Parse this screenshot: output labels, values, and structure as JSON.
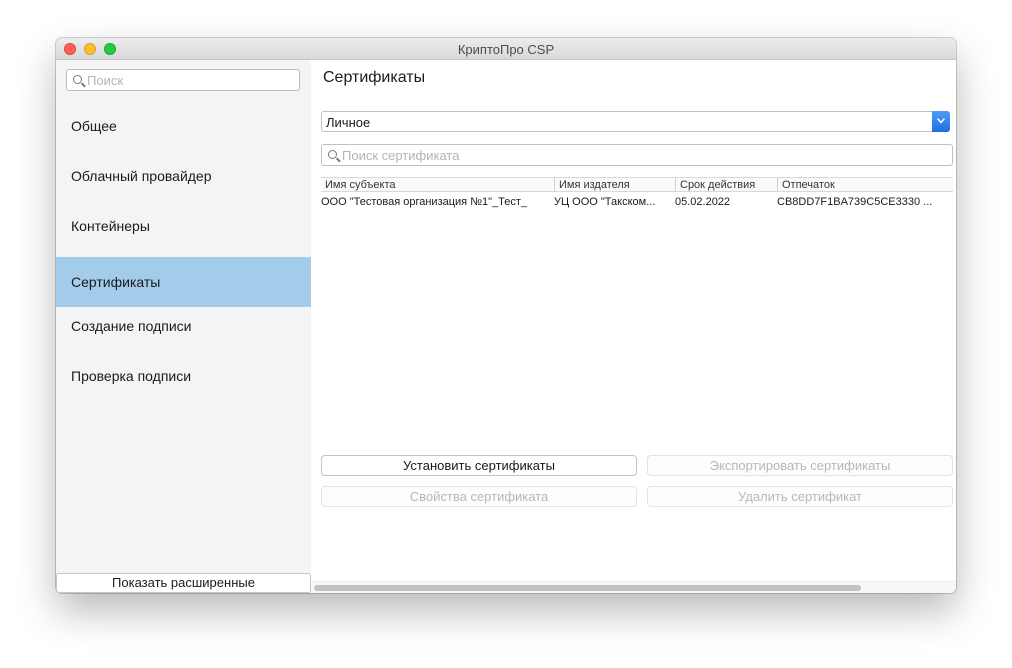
{
  "window": {
    "title": "КриптоПро CSP"
  },
  "sidebar": {
    "search_placeholder": "Поиск",
    "items": [
      {
        "label": "Общее"
      },
      {
        "label": "Облачный провайдер"
      },
      {
        "label": "Контейнеры"
      },
      {
        "label": "Сертификаты",
        "active": true
      },
      {
        "label": "Создание подписи"
      },
      {
        "label": "Проверка подписи"
      }
    ],
    "show_advanced_label": "Показать расширенные"
  },
  "main": {
    "title": "Сертификаты",
    "store_select": {
      "selected": "Личное"
    },
    "cert_search_placeholder": "Поиск сертификата",
    "table": {
      "columns": [
        "Имя субъекта",
        "Имя издателя",
        "Срок действия",
        "Отпечаток"
      ],
      "rows": [
        {
          "subject": "ООО \"Тестовая организация №1\"_Тест_",
          "issuer": "УЦ ООО \"Такском...",
          "valid_until": "05.02.2022",
          "thumbprint": "CB8DD7F1BA739C5CE3330 ..."
        }
      ]
    },
    "buttons": {
      "install": "Установить сертификаты",
      "export": "Экспортировать сертификаты",
      "properties": "Свойства сертификата",
      "delete": "Удалить сертификат"
    }
  },
  "colors": {
    "selection": "#a3cbea",
    "select_accent": "#1b6fe0",
    "close": "#fe5f57",
    "minimize": "#febc2e",
    "zoom": "#28c840"
  }
}
